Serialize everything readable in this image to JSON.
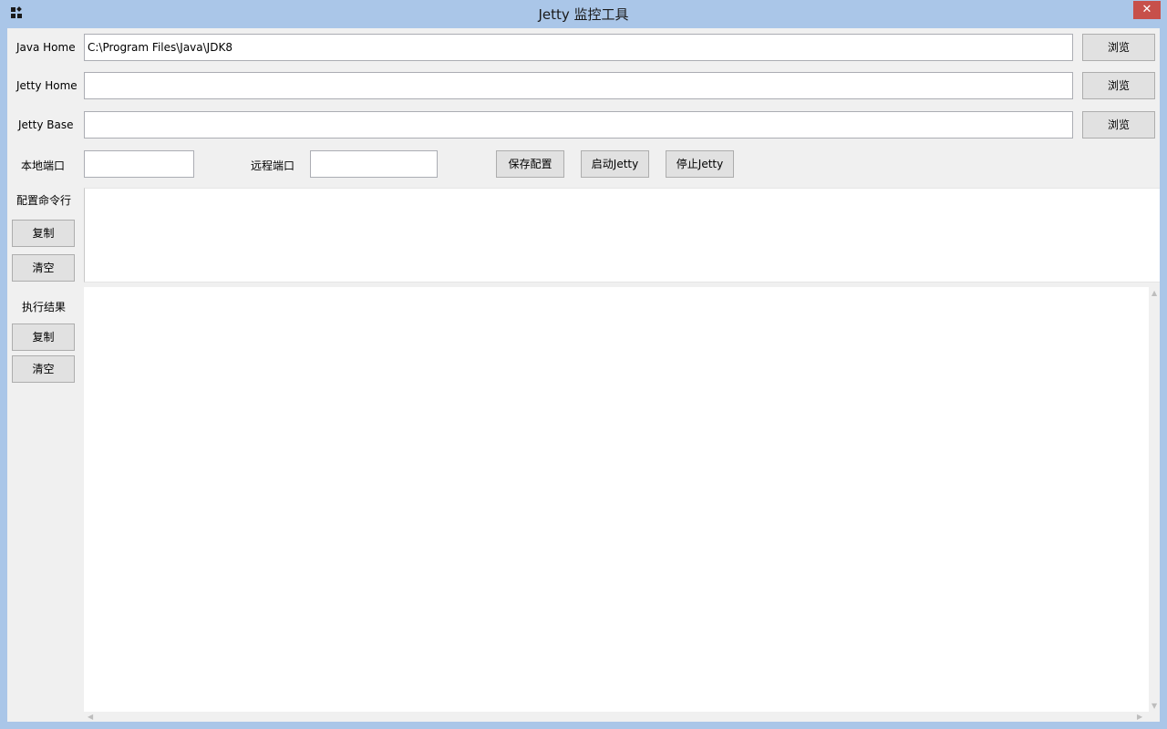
{
  "window": {
    "title": "Jetty 监控工具",
    "close_glyph": "✕"
  },
  "config": {
    "java_home": {
      "label": "Java Home",
      "value": "C:\\Program Files\\Java\\JDK8",
      "browse_label": "浏览"
    },
    "jetty_home": {
      "label": "Jetty Home",
      "value": "",
      "browse_label": "浏览"
    },
    "jetty_base": {
      "label": "Jetty Base",
      "value": "",
      "browse_label": "浏览"
    },
    "local_port": {
      "label": "本地端口",
      "value": ""
    },
    "remote_port": {
      "label": "远程端口",
      "value": ""
    },
    "save_label": "保存配置",
    "start_label": "启动Jetty",
    "stop_label": "停止Jetty"
  },
  "command_line": {
    "label": "配置命令行",
    "copy_label": "复制",
    "clear_label": "清空",
    "content": ""
  },
  "result": {
    "label": "执行结果",
    "copy_label": "复制",
    "clear_label": "清空",
    "content": ""
  },
  "icons": {
    "app": "app-grid-icon",
    "close": "close-icon",
    "scroll_up": "chevron-up-icon",
    "scroll_down": "chevron-down-icon",
    "scroll_left": "chevron-left-icon",
    "scroll_right": "chevron-right-icon"
  },
  "colors": {
    "titlebar": "#aac6e8",
    "close_button": "#c7504a",
    "client_background": "#f0f0f0",
    "button_face": "#e1e1e1"
  }
}
